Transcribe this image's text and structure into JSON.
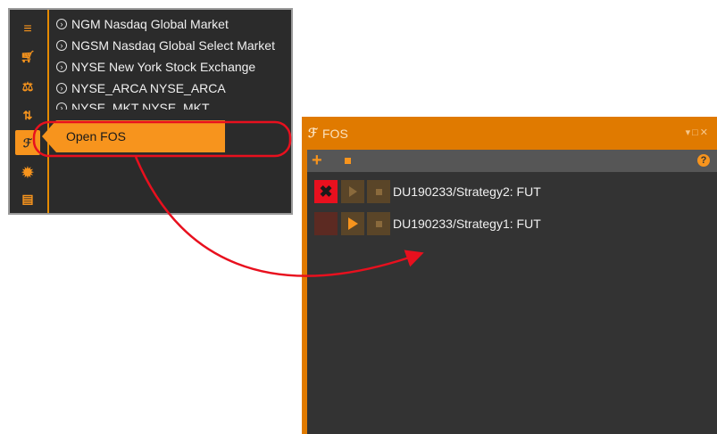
{
  "left_menu": {
    "markets": [
      "NGM Nasdaq Global Market",
      "NGSM Nasdaq Global Select Market",
      "NYSE New York Stock Exchange",
      "NYSE_ARCA NYSE_ARCA",
      "NYSE_MKT NYSE_MKT"
    ],
    "tooltip": "Open FOS",
    "icons": [
      "hamburger-menu-icon",
      "cart-icon",
      "scale-icon",
      "sort-icon",
      "fos-icon",
      "gear-icon",
      "document-icon"
    ]
  },
  "fos_window": {
    "title": "FOS",
    "strategies": [
      {
        "label": "DU190233/Strategy2: FUT",
        "state": "running"
      },
      {
        "label": "DU190233/Strategy1: FUT",
        "state": "stopped"
      }
    ]
  },
  "colors": {
    "accent": "#f7941d",
    "title_orange": "#e07a00",
    "annotation_red": "#e8101e"
  }
}
